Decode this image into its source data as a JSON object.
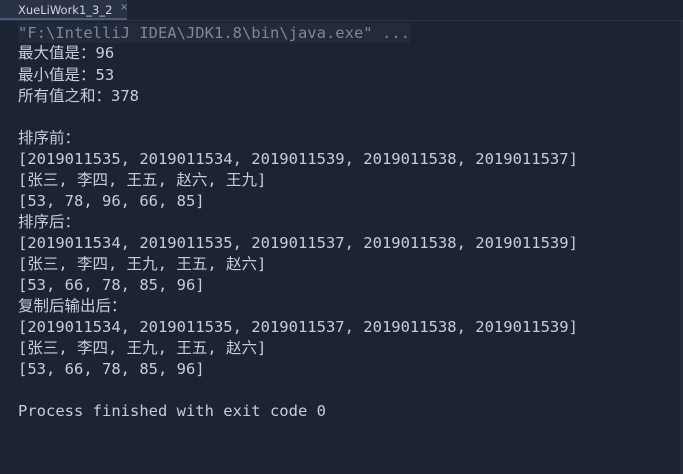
{
  "tab": {
    "title": "XueLiWork1_3_2",
    "close_glyph": "×"
  },
  "console": {
    "command": "\"F:\\IntelliJ IDEA\\JDK1.8\\bin\\java.exe\" ...",
    "lines": [
      "最大值是：96",
      "最小值是：53",
      "所有值之和：378",
      "",
      "排序前：",
      "[2019011535, 2019011534, 2019011539, 2019011538, 2019011537]",
      "[张三, 李四, 王五, 赵六, 王九]",
      "[53, 78, 96, 66, 85]",
      "排序后：",
      "[2019011534, 2019011535, 2019011537, 2019011538, 2019011539]",
      "[张三, 李四, 王九, 王五, 赵六]",
      "[53, 66, 78, 85, 96]",
      "复制后输出后：",
      "[2019011534, 2019011535, 2019011537, 2019011538, 2019011539]",
      "[张三, 李四, 王九, 王五, 赵六]",
      "[53, 66, 78, 85, 96]",
      "",
      "Process finished with exit code 0"
    ]
  }
}
